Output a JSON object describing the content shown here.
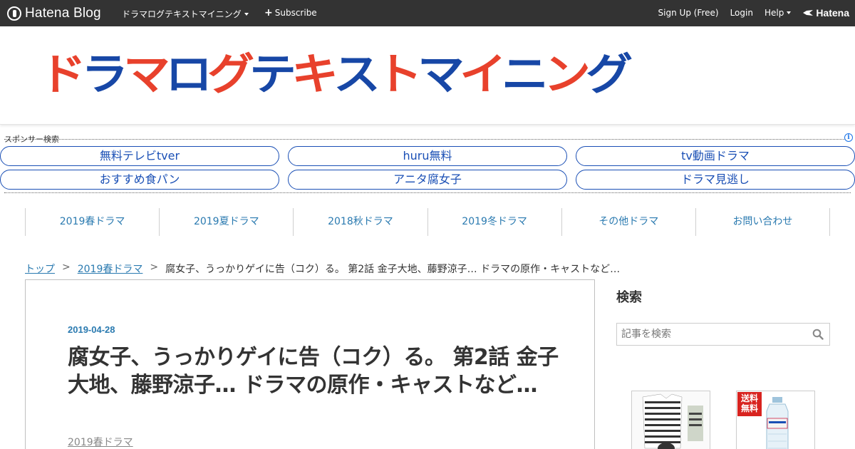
{
  "topbar": {
    "brand": "Hatena Blog",
    "blog_name": "ドラマログテキストマイニング",
    "subscribe": "Subscribe",
    "sign_up": "Sign Up (Free)",
    "login": "Login",
    "help": "Help",
    "hatena": "Hatena"
  },
  "header": {
    "banner": [
      {
        "char": "ド",
        "color": "red"
      },
      {
        "char": "ラ",
        "color": "blue"
      },
      {
        "char": "マ",
        "color": "red"
      },
      {
        "char": "ロ",
        "color": "blue"
      },
      {
        "char": "グ",
        "color": "red"
      },
      {
        "char": "テ",
        "color": "blue"
      },
      {
        "char": "キ",
        "color": "red"
      },
      {
        "char": "ス",
        "color": "blue"
      },
      {
        "char": "ト",
        "color": "red"
      },
      {
        "char": "マ",
        "color": "blue"
      },
      {
        "char": "イ",
        "color": "red"
      },
      {
        "char": "ニ",
        "color": "blue"
      },
      {
        "char": "ン",
        "color": "red"
      },
      {
        "char": "グ",
        "color": "blue"
      }
    ],
    "colors": {
      "red": "#e8412c",
      "blue": "#1747a6"
    }
  },
  "sponsor": {
    "label": "スポンサー検索",
    "links": [
      "無料テレビtver",
      "huru無料",
      "tv動画ドラマ",
      "おすすめ食パン",
      "アニタ腐女子",
      "ドラマ見逃し"
    ]
  },
  "nav": [
    "2019春ドラマ",
    "2019夏ドラマ",
    "2018秋ドラマ",
    "2019冬ドラマ",
    "その他ドラマ",
    "お問い合わせ"
  ],
  "breadcrumb": {
    "top": "トップ",
    "category": "2019春ドラマ",
    "current": "腐女子、うっかりゲイに告（コク）る。 第2話 金子大地、藤野涼子… ドラマの原作・キャストなど…",
    "separator": ">"
  },
  "article": {
    "date": "2019-04-28",
    "title": "腐女子、うっかりゲイに告（コク）る。 第2話 金子大地、藤野涼子… ドラマの原作・キャストなど…",
    "category": "2019春ドラマ"
  },
  "sidebar": {
    "search_title": "検索",
    "search_placeholder": "記事を検索",
    "ads": [
      {
        "badge": ""
      },
      {
        "badge": "送料無料"
      }
    ]
  }
}
